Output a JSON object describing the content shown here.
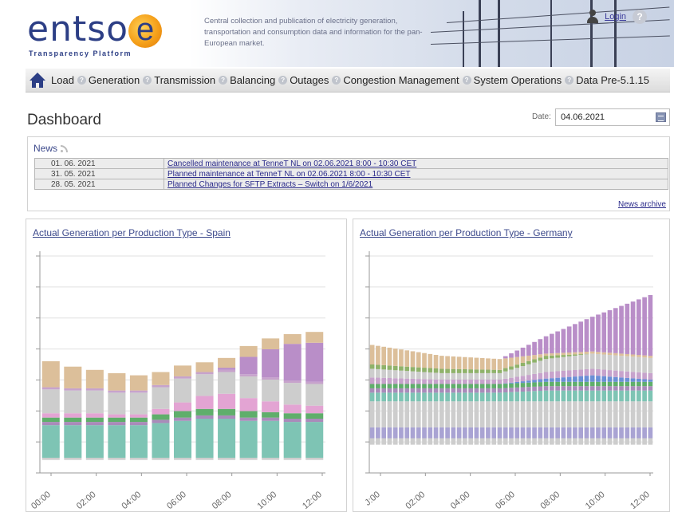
{
  "header": {
    "logo_text": "entso",
    "logo_letter": "e",
    "logo_tagline": "Transparency Platform",
    "tagline": "Central collection and publication of electricity generation, transportation and consumption data and information for the pan-European market.",
    "login_label": "Login",
    "help_glyph": "?"
  },
  "nav": {
    "items": [
      {
        "label": "Load"
      },
      {
        "label": "Generation"
      },
      {
        "label": "Transmission"
      },
      {
        "label": "Balancing"
      },
      {
        "label": "Outages"
      },
      {
        "label": "Congestion Management"
      },
      {
        "label": "System Operations"
      },
      {
        "label": "Data Pre-5.1.15"
      }
    ],
    "help_glyph": "?"
  },
  "dashboard": {
    "title": "Dashboard",
    "date_label": "Date:",
    "date_value": "04.06.2021"
  },
  "news": {
    "heading": "News",
    "items": [
      {
        "date": "01. 06. 2021",
        "text": "Cancelled maintenance at TenneT NL on 02.06.2021 8:00 - 10:30 CET"
      },
      {
        "date": "31. 05. 2021",
        "text": "Planned maintenance at TenneT NL on 02.06.2021 8:00 - 10:30 CET"
      },
      {
        "date": "28. 05. 2021",
        "text": "Planned Changes for SFTP Extracts – Switch on 1/6/2021"
      }
    ],
    "archive_label": "News archive"
  },
  "colors": {
    "nuclear": "#a9a3d3",
    "teal": "#7ec4b4",
    "purple_dark": "#a98bba",
    "green": "#5fae6b",
    "pink": "#e3a4d3",
    "grey": "#cdcdcd",
    "lavender": "#c7a3cc",
    "tan": "#dcbf9a",
    "violet": "#b98ec8",
    "blue": "#6a8fd6",
    "olive": "#8fb26a",
    "grid": "#e0e0e0",
    "axis": "#999999"
  },
  "chart_data": [
    {
      "type": "bar",
      "stacked": true,
      "title": "Actual Generation per Production Type - Spain",
      "x_ticks": [
        "00:00",
        "02:00",
        "04:00",
        "06:00",
        "08:00",
        "10:00",
        "12:00"
      ],
      "ylim": [
        0,
        100
      ],
      "stack_order": [
        "base_grey",
        "teal",
        "purple_dark",
        "green",
        "pink",
        "grey",
        "lavender",
        "violet",
        "tan"
      ],
      "bars": [
        {
          "base_grey": 1,
          "teal": 15,
          "purple_dark": 1.5,
          "green": 2,
          "pink": 2,
          "grey": 11,
          "lavender": 1,
          "violet": 0,
          "tan": 12
        },
        {
          "base_grey": 1,
          "teal": 15,
          "purple_dark": 1.5,
          "green": 2,
          "pink": 2,
          "grey": 10.5,
          "lavender": 1,
          "violet": 0,
          "tan": 10
        },
        {
          "base_grey": 1,
          "teal": 15,
          "purple_dark": 1.5,
          "green": 2,
          "pink": 2,
          "grey": 10.5,
          "lavender": 1,
          "violet": 0,
          "tan": 8.5
        },
        {
          "base_grey": 1,
          "teal": 15,
          "purple_dark": 1.5,
          "green": 2,
          "pink": 1.5,
          "grey": 10,
          "lavender": 1,
          "violet": 0,
          "tan": 8
        },
        {
          "base_grey": 1,
          "teal": 15,
          "purple_dark": 1.5,
          "green": 2,
          "pink": 1.5,
          "grey": 10,
          "lavender": 1,
          "violet": 0,
          "tan": 7
        },
        {
          "base_grey": 1,
          "teal": 16,
          "purple_dark": 1.5,
          "green": 2.5,
          "pink": 2.5,
          "grey": 10,
          "lavender": 1,
          "violet": 0,
          "tan": 6
        },
        {
          "base_grey": 1,
          "teal": 17,
          "purple_dark": 1.5,
          "green": 3,
          "pink": 4,
          "grey": 11,
          "lavender": 1,
          "violet": 0,
          "tan": 5
        },
        {
          "base_grey": 1,
          "teal": 18,
          "purple_dark": 1.5,
          "green": 3,
          "pink": 6,
          "grey": 10,
          "lavender": 1,
          "violet": 0,
          "tan": 4.5
        },
        {
          "base_grey": 1,
          "teal": 18,
          "purple_dark": 1.5,
          "green": 3,
          "pink": 7,
          "grey": 10,
          "lavender": 1,
          "violet": 1,
          "tan": 4.5
        },
        {
          "base_grey": 1,
          "teal": 17,
          "purple_dark": 1.5,
          "green": 3,
          "pink": 6,
          "grey": 10,
          "lavender": 1,
          "violet": 8,
          "tan": 5
        },
        {
          "base_grey": 1,
          "teal": 17,
          "purple_dark": 1.5,
          "green": 2.5,
          "pink": 5,
          "grey": 10,
          "lavender": 1,
          "violet": 13,
          "tan": 5
        },
        {
          "base_grey": 1,
          "teal": 16.5,
          "purple_dark": 1.5,
          "green": 2.5,
          "pink": 4,
          "grey": 10,
          "lavender": 1,
          "violet": 17,
          "tan": 4.5
        },
        {
          "base_grey": 1,
          "teal": 16.5,
          "purple_dark": 1.5,
          "green": 2.5,
          "pink": 3.5,
          "grey": 10,
          "lavender": 1,
          "violet": 18,
          "tan": 5
        }
      ]
    },
    {
      "type": "bar",
      "stacked": true,
      "title": "Actual Generation per Production Type - Germany",
      "x_ticks": [
        "J:00",
        "02:00",
        "04:00",
        "06:00",
        "08:00",
        "10:00",
        "12:00"
      ],
      "ylim": [
        0,
        100
      ],
      "stack_order": [
        "base_grey",
        "nuclear",
        "grey",
        "teal",
        "purple_dark",
        "green",
        "blue",
        "lavender",
        "grey2",
        "olive",
        "tan",
        "violet"
      ],
      "bar_count": 49,
      "keyframes": [
        {
          "i": 0,
          "base_grey": 3,
          "nuclear": 5,
          "grey": 12,
          "teal": 4,
          "purple_dark": 2,
          "green": 2,
          "blue": 0,
          "lavender": 3,
          "grey2": 4,
          "olive": 2,
          "tan": 9,
          "violet": 0
        },
        {
          "i": 12,
          "base_grey": 3,
          "nuclear": 5,
          "grey": 12,
          "teal": 4,
          "purple_dark": 2,
          "green": 2,
          "blue": 0,
          "lavender": 2,
          "grey2": 3,
          "olive": 2,
          "tan": 6,
          "violet": 0
        },
        {
          "i": 22,
          "base_grey": 3,
          "nuclear": 5,
          "grey": 12,
          "teal": 4,
          "purple_dark": 2,
          "green": 2,
          "blue": 0,
          "lavender": 2,
          "grey2": 3,
          "olive": 1.5,
          "tan": 5,
          "violet": 0
        },
        {
          "i": 30,
          "base_grey": 3,
          "nuclear": 5,
          "grey": 12,
          "teal": 5,
          "purple_dark": 2,
          "green": 2,
          "blue": 1.5,
          "lavender": 3,
          "grey2": 6,
          "olive": 1.5,
          "tan": 1,
          "violet": 8
        },
        {
          "i": 38,
          "base_grey": 3,
          "nuclear": 5,
          "grey": 12,
          "teal": 5,
          "purple_dark": 2,
          "green": 2,
          "blue": 3,
          "lavender": 3,
          "grey2": 7,
          "olive": 0,
          "tan": 1,
          "violet": 16
        },
        {
          "i": 48,
          "base_grey": 3,
          "nuclear": 5,
          "grey": 12,
          "teal": 5,
          "purple_dark": 2,
          "green": 2,
          "blue": 1,
          "lavender": 3,
          "grey2": 7,
          "olive": 0,
          "tan": 1,
          "violet": 28
        }
      ]
    }
  ]
}
